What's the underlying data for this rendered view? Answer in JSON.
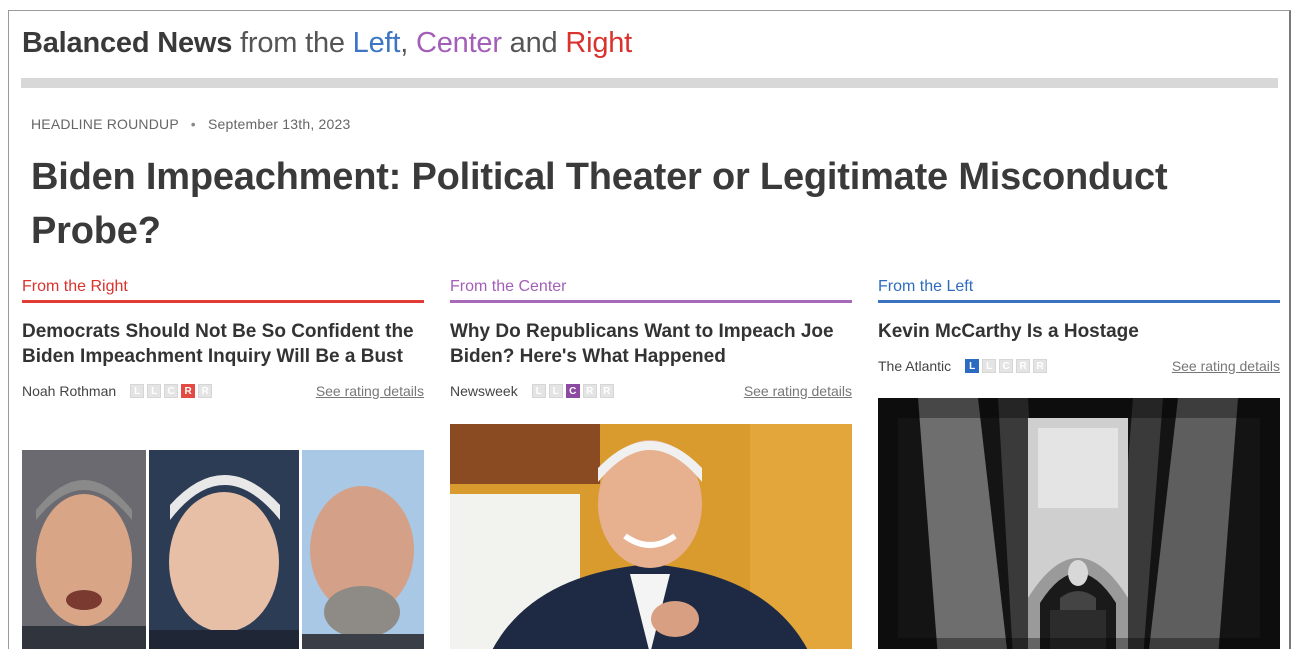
{
  "site": {
    "brand": "Balanced News",
    "from_the": "from the",
    "left": "Left",
    "comma": ",",
    "center": "Center",
    "and": "and",
    "right": "Right"
  },
  "roundup": {
    "kicker": "HEADLINE ROUNDUP",
    "separator": "•",
    "date": "September 13th, 2023",
    "headline": "Biden Impeachment: Political Theater or Legitimate Misconduct Probe?"
  },
  "columns": [
    {
      "side": "From the Right",
      "title": "Democrats Should Not Be So Confident the Biden Impeachment Inquiry Will Be a Bust",
      "source": "Noah Rothman",
      "rating": [
        "L",
        "L",
        "C",
        "R",
        "R"
      ],
      "active": 3,
      "details": "See rating details",
      "image": "photo-three-politicians"
    },
    {
      "side": "From the Center",
      "title": "Why Do Republicans Want to Impeach Joe Biden? Here's What Happened",
      "source": "Newsweek",
      "rating": [
        "L",
        "L",
        "C",
        "R",
        "R"
      ],
      "active": 2,
      "details": "See rating details",
      "image": "photo-biden-smiling"
    },
    {
      "side": "From the Left",
      "title": "Kevin McCarthy Is a Hostage",
      "source": "The Atlantic",
      "rating": [
        "L",
        "L",
        "C",
        "R",
        "R"
      ],
      "active": 0,
      "details": "See rating details",
      "image": "photo-mccarthy-columns"
    }
  ],
  "colors": {
    "left": "#3b76c4",
    "center": "#a35fb7",
    "right": "#d9332e"
  }
}
